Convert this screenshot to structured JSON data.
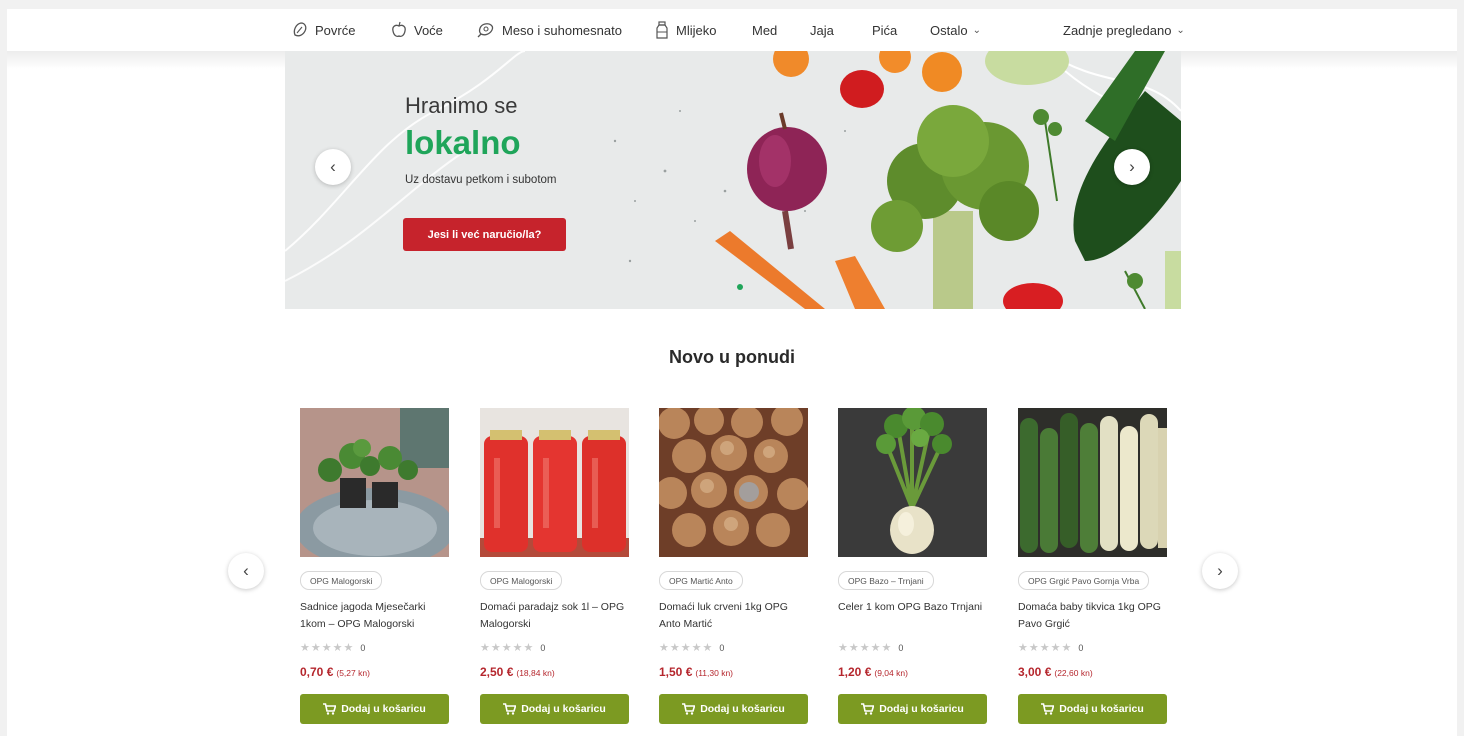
{
  "nav": {
    "items": [
      {
        "label": "Povrće",
        "icon": "vegetable-icon"
      },
      {
        "label": "Voće",
        "icon": "apple-icon"
      },
      {
        "label": "Meso i suhomesnato",
        "icon": "meat-icon"
      },
      {
        "label": "Mlijeko",
        "icon": "milk-bottle-icon"
      },
      {
        "label": "Med"
      },
      {
        "label": "Jaja"
      },
      {
        "label": "Pića"
      },
      {
        "label": "Ostalo",
        "dropdown": true
      }
    ],
    "recently_viewed": "Zadnje pregledano"
  },
  "hero": {
    "title_line1": "Hranimo se",
    "title_line2": "lokalno",
    "subtitle": "Uz dostavu petkom i subotom",
    "cta": "Jesi li već naručio/la?",
    "prev_icon": "chevron-left-icon",
    "next_icon": "chevron-right-icon"
  },
  "section_title": "Novo u ponudi",
  "products": [
    {
      "seller": "OPG Malogorski",
      "name": "Sadnice jagoda Mjesečarki 1kom – OPG Malogorski",
      "rating_count": "0",
      "price": "0,70 €",
      "price_kn": "(5,27 kn)",
      "button": "Dodaj u košaricu"
    },
    {
      "seller": "OPG Malogorski",
      "name": "Domaći paradajz sok 1l – OPG Malogorski",
      "rating_count": "0",
      "price": "2,50 €",
      "price_kn": "(18,84 kn)",
      "button": "Dodaj u košaricu"
    },
    {
      "seller": "OPG Martić Anto",
      "name": "Domaći luk crveni 1kg OPG Anto Martić",
      "rating_count": "0",
      "price": "1,50 €",
      "price_kn": "(11,30 kn)",
      "button": "Dodaj u košaricu"
    },
    {
      "seller": "OPG Bazo – Trnjani",
      "name": "Celer 1 kom OPG Bazo Trnjani",
      "rating_count": "0",
      "price": "1,20 €",
      "price_kn": "(9,04 kn)",
      "button": "Dodaj u košaricu"
    },
    {
      "seller": "OPG Grgić Pavo Gornja Vrba",
      "name": "Domaća baby tikvica 1kg OPG Pavo Grgić",
      "rating_count": "0",
      "price": "3,00 €",
      "price_kn": "(22,60 kn)",
      "button": "Dodaj u košaricu"
    }
  ],
  "colors": {
    "brand_green": "#1fa55a",
    "cta_red": "#c6232c",
    "button_olive": "#7c9a22",
    "price_red": "#b5262d"
  }
}
